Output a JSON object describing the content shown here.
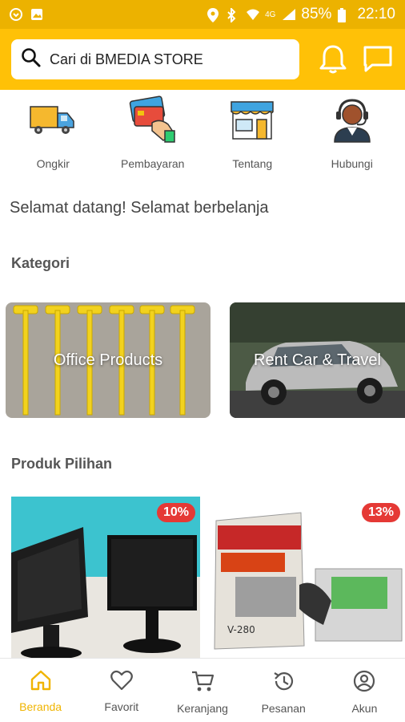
{
  "status_bar": {
    "battery": "85%",
    "time": "22:10",
    "network": "4G"
  },
  "header": {
    "search_placeholder": "Cari di BMEDIA STORE"
  },
  "shortcuts": [
    {
      "label": "Ongkir",
      "icon": "truck-icon"
    },
    {
      "label": "Pembayaran",
      "icon": "card-payment-icon"
    },
    {
      "label": "Tentang",
      "icon": "store-icon"
    },
    {
      "label": "Hubungi",
      "icon": "support-agent-icon"
    }
  ],
  "welcome_text": "Selamat datang! Selamat berbelanja",
  "kategori": {
    "title": "Kategori",
    "items": [
      {
        "label": "Office Products"
      },
      {
        "label": "Rent Car & Travel"
      }
    ]
  },
  "produk_pilihan": {
    "title": "Produk Pilihan",
    "items": [
      {
        "discount": "10%"
      },
      {
        "discount": "13%"
      }
    ]
  },
  "bottom_nav": [
    {
      "label": "Beranda",
      "icon": "home-icon",
      "active": true
    },
    {
      "label": "Favorit",
      "icon": "heart-icon"
    },
    {
      "label": "Keranjang",
      "icon": "cart-icon"
    },
    {
      "label": "Pesanan",
      "icon": "history-icon"
    },
    {
      "label": "Akun",
      "icon": "account-icon"
    }
  ],
  "colors": {
    "primary": "#ffc107",
    "status_bar": "#ecb200",
    "badge": "#e53935",
    "active_nav": "#f0b400"
  }
}
